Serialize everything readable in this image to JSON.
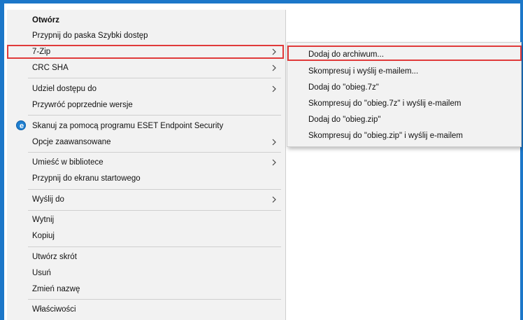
{
  "context_menu": {
    "items": [
      {
        "label": "Otwórz"
      },
      {
        "label": "Przypnij do paska Szybki dostęp"
      },
      {
        "label": "7-Zip"
      },
      {
        "label": "CRC SHA"
      },
      {
        "label": "Udziel dostępu do"
      },
      {
        "label": "Przywróć poprzednie wersje"
      },
      {
        "label": "Skanuj za pomocą programu ESET Endpoint Security"
      },
      {
        "label": "Opcje zaawansowane"
      },
      {
        "label": "Umieść w bibliotece"
      },
      {
        "label": "Przypnij do ekranu startowego"
      },
      {
        "label": "Wyślij do"
      },
      {
        "label": "Wytnij"
      },
      {
        "label": "Kopiuj"
      },
      {
        "label": "Utwórz skrót"
      },
      {
        "label": "Usuń"
      },
      {
        "label": "Zmień nazwę"
      },
      {
        "label": "Właściwości"
      }
    ]
  },
  "submenu_7zip": {
    "items": [
      {
        "label": "Dodaj do archiwum..."
      },
      {
        "label": "Skompresuj i wyślij e-mailem..."
      },
      {
        "label": "Dodaj do \"obieg.7z\""
      },
      {
        "label": "Skompresuj do \"obieg.7z\" i wyślij e-mailem"
      },
      {
        "label": "Dodaj do \"obieg.zip\""
      },
      {
        "label": "Skompresuj do \"obieg.zip\" i wyślij e-mailem"
      }
    ]
  },
  "colors": {
    "highlight_border": "#e03a3a",
    "window_edge": "#1c77c9",
    "menu_background": "#f2f2f2"
  },
  "icons": {
    "eset": "eset-shield-icon",
    "submenu_arrow": "chevron-right-icon"
  }
}
